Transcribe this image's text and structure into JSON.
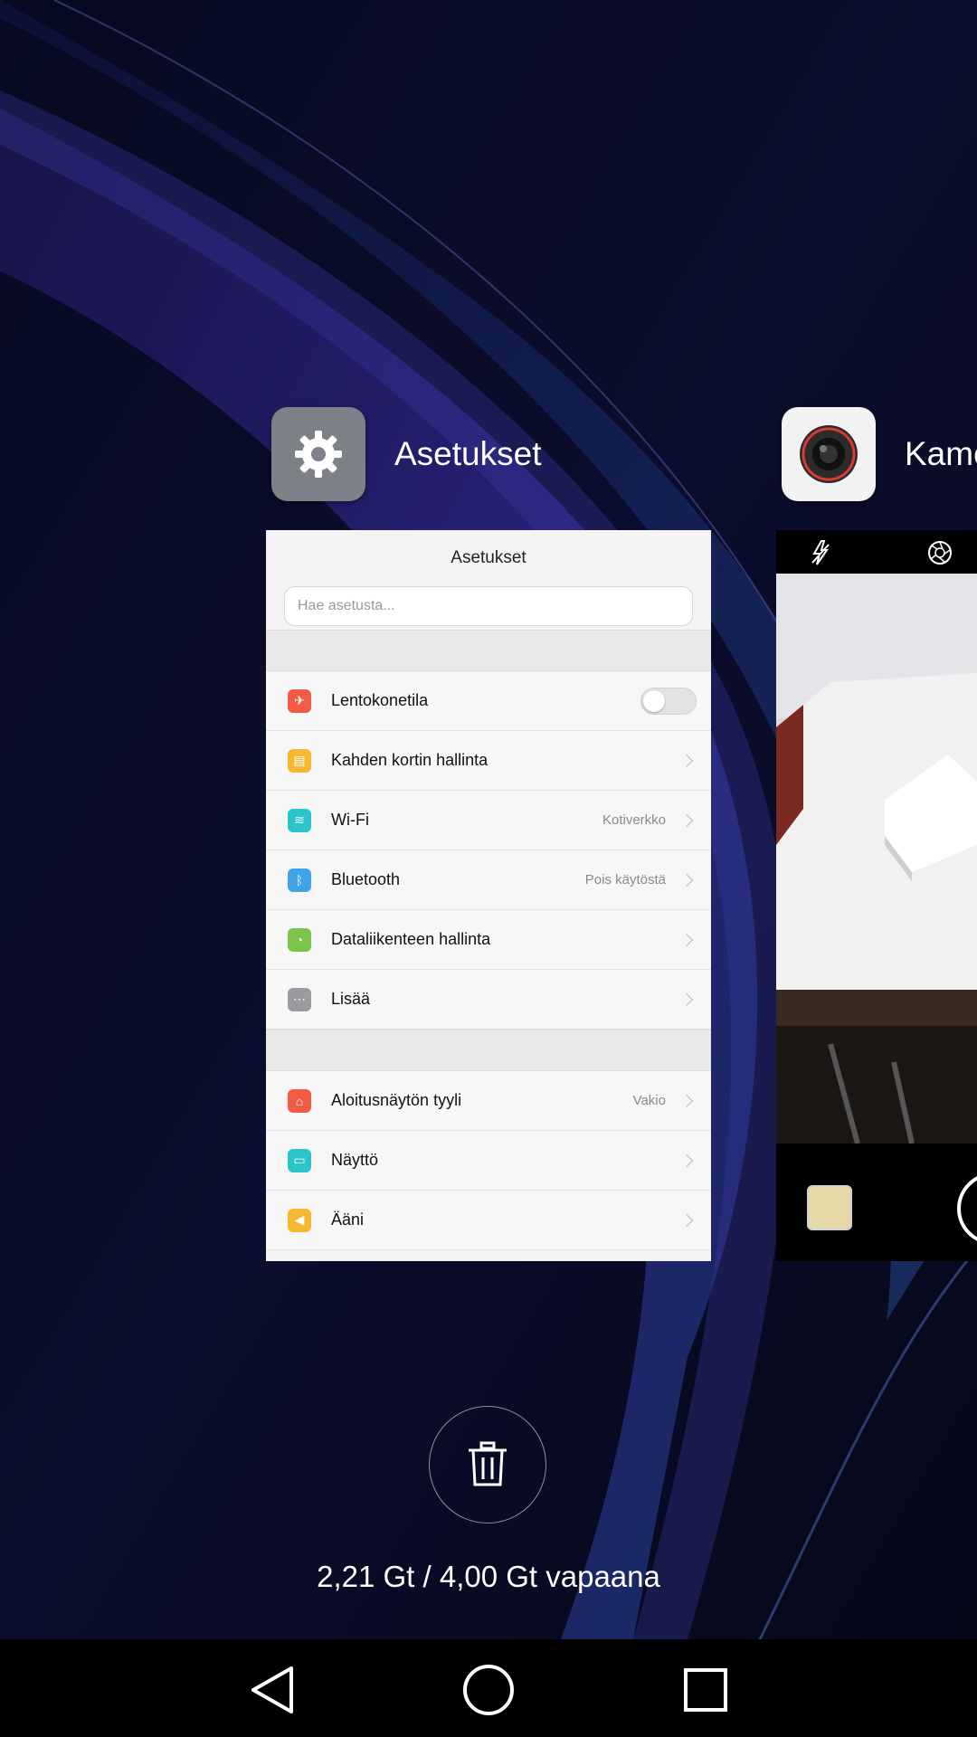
{
  "recents": {
    "apps": [
      {
        "title": "Asetukset",
        "icon": "settings-gear-icon",
        "icon_color": "#7d8288"
      },
      {
        "title": "Kame",
        "icon": "camera-lens-icon",
        "icon_color": "#f2f2f2"
      }
    ]
  },
  "settings_preview": {
    "title": "Asetukset",
    "search_placeholder": "Hae asetusta...",
    "group1": [
      {
        "label": "Lentokonetila",
        "value": "",
        "icon": "airplane-icon",
        "icon_color": "#f25b44",
        "control": "toggle",
        "toggle_on": false
      },
      {
        "label": "Kahden kortin hallinta",
        "value": "",
        "icon": "sim-card-icon",
        "icon_color": "#f6b833",
        "control": "chevron"
      },
      {
        "label": "Wi-Fi",
        "value": "Kotiverkko",
        "icon": "wifi-icon",
        "icon_color": "#2bc4c9",
        "control": "chevron"
      },
      {
        "label": "Bluetooth",
        "value": "Pois käytöstä",
        "icon": "bluetooth-icon",
        "icon_color": "#3fa4e8",
        "control": "chevron"
      },
      {
        "label": "Dataliikenteen hallinta",
        "value": "",
        "icon": "data-usage-icon",
        "icon_color": "#7cc34a",
        "control": "chevron"
      },
      {
        "label": "Lisää",
        "value": "",
        "icon": "more-icon",
        "icon_color": "#9a9aa0",
        "control": "chevron"
      }
    ],
    "group2": [
      {
        "label": "Aloitusnäytön tyyli",
        "value": "Vakio",
        "icon": "home-icon",
        "icon_color": "#f25b44",
        "control": "chevron"
      },
      {
        "label": "Näyttö",
        "value": "",
        "icon": "display-icon",
        "icon_color": "#2bc4c9",
        "control": "chevron"
      },
      {
        "label": "Ääni",
        "value": "",
        "icon": "sound-icon",
        "icon_color": "#f6b833",
        "control": "chevron"
      }
    ]
  },
  "camera_preview": {
    "top_icons": [
      "flash-off-icon",
      "aperture-icon"
    ]
  },
  "clear_button": {
    "icon": "trash-icon"
  },
  "memory": {
    "text": "2,21 Gt / 4,00 Gt vapaana"
  },
  "navbar": {
    "buttons": [
      "back-icon",
      "home-circle-icon",
      "recents-square-icon"
    ]
  }
}
